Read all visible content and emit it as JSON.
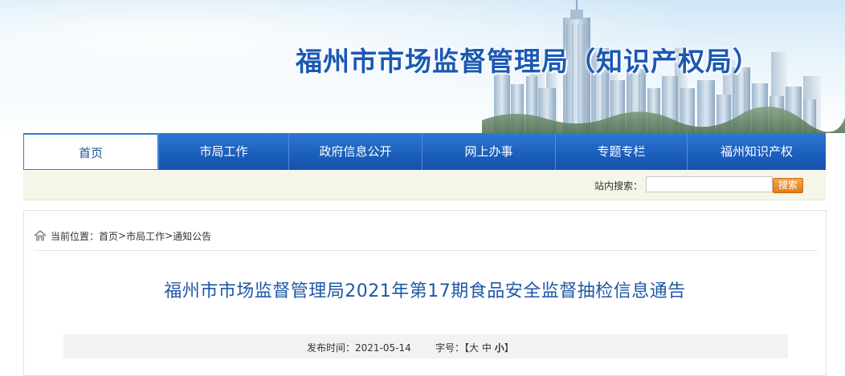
{
  "banner": {
    "title": "福州市市场监督管理局（知识产权局）"
  },
  "nav": {
    "items": [
      {
        "label": "首页"
      },
      {
        "label": "市局工作"
      },
      {
        "label": "政府信息公开"
      },
      {
        "label": "网上办事"
      },
      {
        "label": "专题专栏"
      },
      {
        "label": "福州知识产权"
      }
    ]
  },
  "search": {
    "label": "站内搜索：",
    "value": "",
    "placeholder": "",
    "button": "搜索"
  },
  "breadcrumb": {
    "prefix": "当前位置：",
    "items": [
      "首页",
      "市局工作",
      "通知公告"
    ],
    "separator": ">"
  },
  "article": {
    "title": "福州市市场监督管理局2021年第17期食品安全监督抽检信息通告",
    "publish_label": "发布时间：",
    "publish_date": "2021-05-14",
    "font_label": "字号：",
    "bracket_open": "【",
    "bracket_close": "】",
    "font_sizes": [
      "大",
      "中",
      "小"
    ]
  },
  "colors": {
    "brand_blue": "#1c5fbd",
    "title_blue": "#1f57a6",
    "search_orange": "#e27a12",
    "search_bar_bg": "#f4f6e8"
  },
  "icons": {
    "breadcrumb_home": "home-icon"
  }
}
